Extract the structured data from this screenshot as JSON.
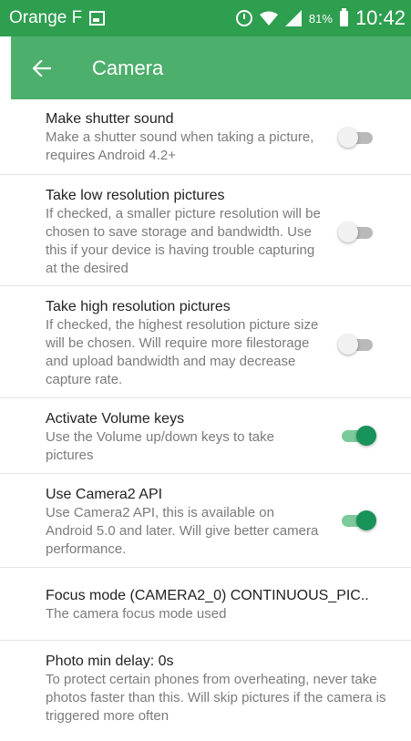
{
  "status_bar": {
    "carrier": "Orange F",
    "battery_percent": "81%",
    "time": "10:42",
    "icons": [
      "image-icon",
      "alarm-icon",
      "wifi-icon",
      "signal-icon",
      "battery-icon"
    ]
  },
  "app_bar": {
    "title": "Camera",
    "back_icon": "arrow-left-icon"
  },
  "colors": {
    "status_bar": "#2e9e4f",
    "app_bar": "#4caf6c",
    "toggle_on": "#18935a",
    "toggle_off": "#b9b9b9"
  },
  "settings": [
    {
      "title": "Make shutter sound",
      "summary": "Make a shutter sound when taking a picture, requires Android 4.2+",
      "checked": false
    },
    {
      "title": "Take low resolution pictures",
      "summary": "If checked, a smaller picture resolution will be chosen to save storage and bandwidth. Use this if your device is having trouble capturing at the desired",
      "checked": false
    },
    {
      "title": "Take high resolution pictures",
      "summary": "If checked, the highest resolution picture size will be chosen. Will require more filestorage and upload bandwidth and may decrease capture rate.",
      "checked": false
    },
    {
      "title": "Activate Volume keys",
      "summary": "Use the Volume up/down keys to take pictures",
      "checked": true
    },
    {
      "title": "Use Camera2 API",
      "summary": "Use Camera2 API, this is available on Android 5.0 and later. Will give better camera performance.",
      "checked": true
    },
    {
      "title": "Focus mode (CAMERA2_0) CONTINUOUS_PIC..",
      "summary": "The camera focus mode used"
    },
    {
      "title": "Photo min delay: 0s",
      "summary": "To protect certain phones from overheating, never take photos faster than this. Will skip pictures if the camera is triggered more often"
    }
  ]
}
